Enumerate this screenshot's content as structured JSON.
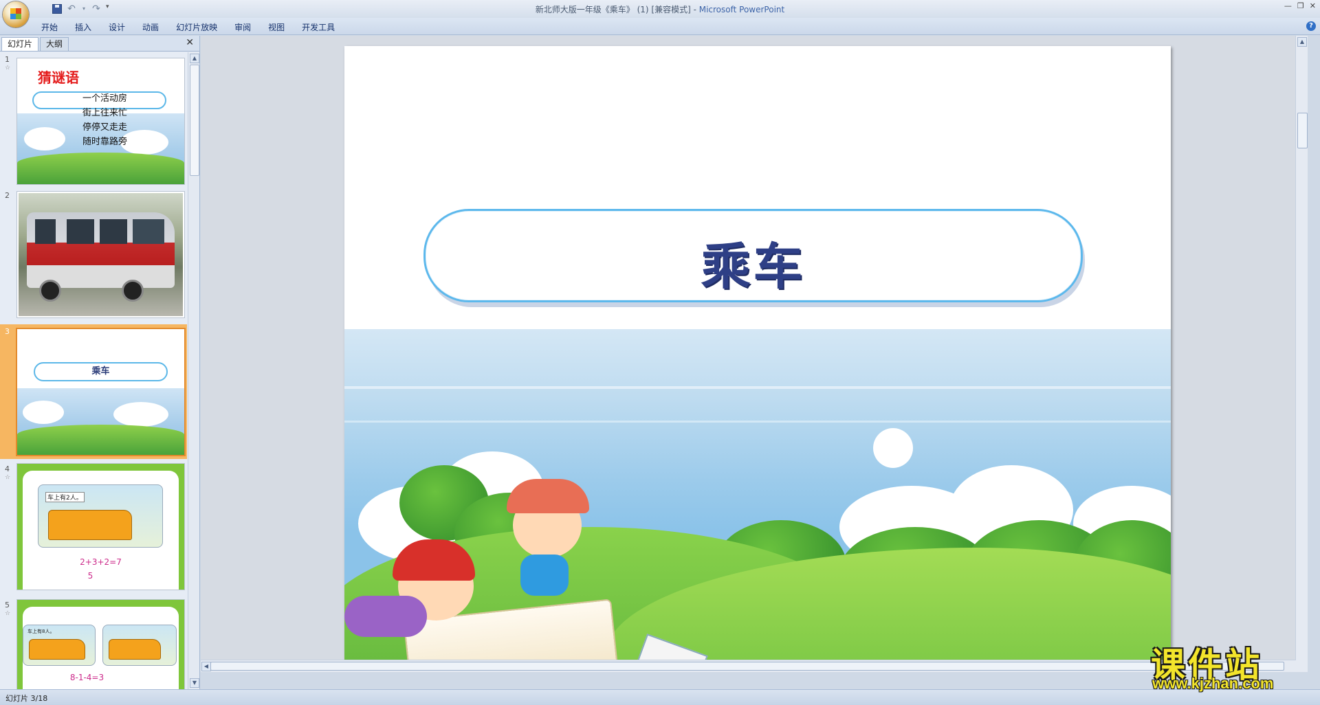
{
  "window": {
    "title_doc": "新北师大版一年级《乘车》 (1) [兼容模式] - ",
    "title_app": "Microsoft PowerPoint"
  },
  "qat": {
    "icons": [
      "save-icon",
      "undo-icon",
      "redo-icon",
      "customize-qat-icon"
    ]
  },
  "ribbon": {
    "tabs": [
      "开始",
      "插入",
      "设计",
      "动画",
      "幻灯片放映",
      "审阅",
      "视图",
      "开发工具"
    ]
  },
  "pane": {
    "tab_slides": "幻灯片",
    "tab_outline": "大纲",
    "close_glyph": "✕"
  },
  "thumbnails": [
    {
      "number": "1",
      "title": "猜谜语",
      "lines": [
        "一个活动房",
        "街上往来忙",
        "停停又走走",
        "随时靠路旁"
      ]
    },
    {
      "number": "2"
    },
    {
      "number": "3",
      "pill_text": "乘车",
      "selected": true
    },
    {
      "number": "4",
      "sign": "车上有2人。",
      "equation": "2+3+2=7",
      "sub": "5"
    },
    {
      "number": "5",
      "sign": "车上有8人。",
      "equation": "8-1-4=3"
    }
  ],
  "slide": {
    "title": "乘车"
  },
  "status": {
    "slide_counter": "幻灯片 3/18"
  },
  "watermark": {
    "text": "课件站",
    "url": "www.kjzhan.com"
  },
  "colors": {
    "title_text": "#2e3f86",
    "pill_border": "#5cb8ec",
    "selected_thumb": "#f6b661",
    "app_title": "#3d64a8"
  }
}
